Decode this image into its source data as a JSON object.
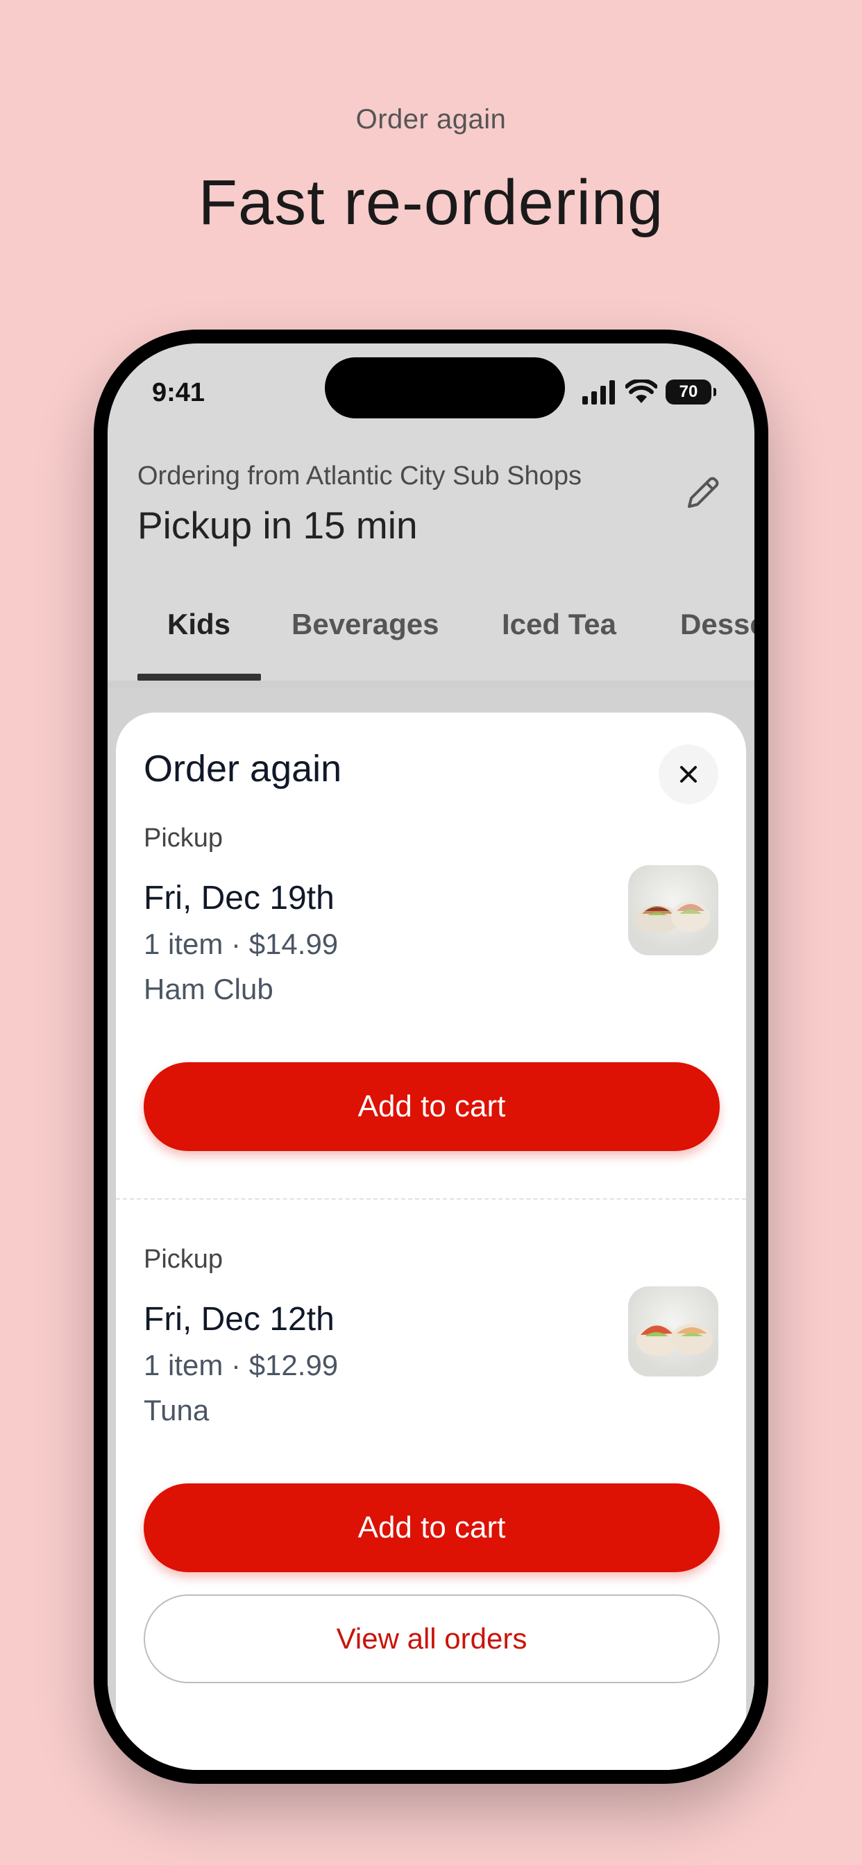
{
  "promo": {
    "kicker": "Order again",
    "title": "Fast re-ordering"
  },
  "status_bar": {
    "time": "9:41",
    "battery": "70"
  },
  "header": {
    "ordering_from": "Ordering from Atlantic City Sub Shops",
    "pickup_time": "Pickup in 15 min",
    "edit_icon": "pencil-icon"
  },
  "tabs": [
    {
      "label": "Kids",
      "active": true
    },
    {
      "label": "Beverages",
      "active": false
    },
    {
      "label": "Iced Tea",
      "active": false
    },
    {
      "label": "Desse",
      "active": false
    }
  ],
  "sheet": {
    "title": "Order again",
    "close_icon": "close-icon",
    "orders": [
      {
        "mode": "Pickup",
        "date": "Fri, Dec 19th",
        "meta": "1 item · $14.99",
        "item": "Ham Club",
        "button": "Add to cart"
      },
      {
        "mode": "Pickup",
        "date": "Fri, Dec 12th",
        "meta": "1 item · $12.99",
        "item": "Tuna",
        "button": "Add to cart"
      }
    ],
    "view_all": "View all orders"
  },
  "colors": {
    "background": "#f7cccb",
    "accent": "#dd1104"
  }
}
